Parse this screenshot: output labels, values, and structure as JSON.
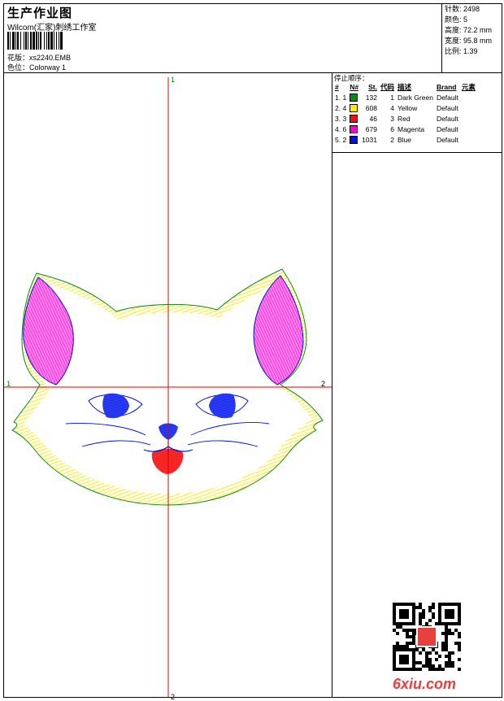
{
  "header": {
    "title": "生产作业图",
    "studio": "Wilcom(汇家)刺绣工作室",
    "design_label": "花版：",
    "design_value": "xs2240.EMB",
    "colorway_label": "色位：",
    "colorway_value": "Colorway 1"
  },
  "stats": {
    "stitches": "针数: 2498",
    "colors": "颜色: 5",
    "height": "高度: 72.2 mm",
    "width": "宽度: 95.8 mm",
    "ratio": "比例: 1.39"
  },
  "stop_sequence": {
    "title": "停止顺序：",
    "columns": [
      "#",
      "N#",
      "St.",
      "代码",
      "描述",
      "Brand",
      "元素"
    ],
    "rows": [
      {
        "idx": "1. 1",
        "stitches": "132",
        "code": "1",
        "desc": "Dark Green",
        "brand": "Default",
        "color": "#0a8a1a"
      },
      {
        "idx": "2. 4",
        "stitches": "608",
        "code": "4",
        "desc": "Yellow",
        "brand": "Default",
        "color": "#ffee00"
      },
      {
        "idx": "3. 3",
        "stitches": "46",
        "code": "3",
        "desc": "Red",
        "brand": "Default",
        "color": "#ee1111"
      },
      {
        "idx": "4. 6",
        "stitches": "679",
        "code": "6",
        "desc": "Magenta",
        "brand": "Default",
        "color": "#ff00cc"
      },
      {
        "idx": "5. 2",
        "stitches": "1031",
        "code": "2",
        "desc": "Blue",
        "brand": "Default",
        "color": "#0011dd"
      }
    ]
  },
  "axes": {
    "top": "1",
    "bottom": "2",
    "left": "1",
    "right": "2"
  },
  "watermark": "6xiu.com",
  "colors": {
    "axis": "#dd0000",
    "axis_label": "#009900",
    "yellow": "#ffee00",
    "magenta": "#ff44dd",
    "blue": "#0011dd",
    "red": "#ee1111",
    "green": "#0a8a1a"
  }
}
